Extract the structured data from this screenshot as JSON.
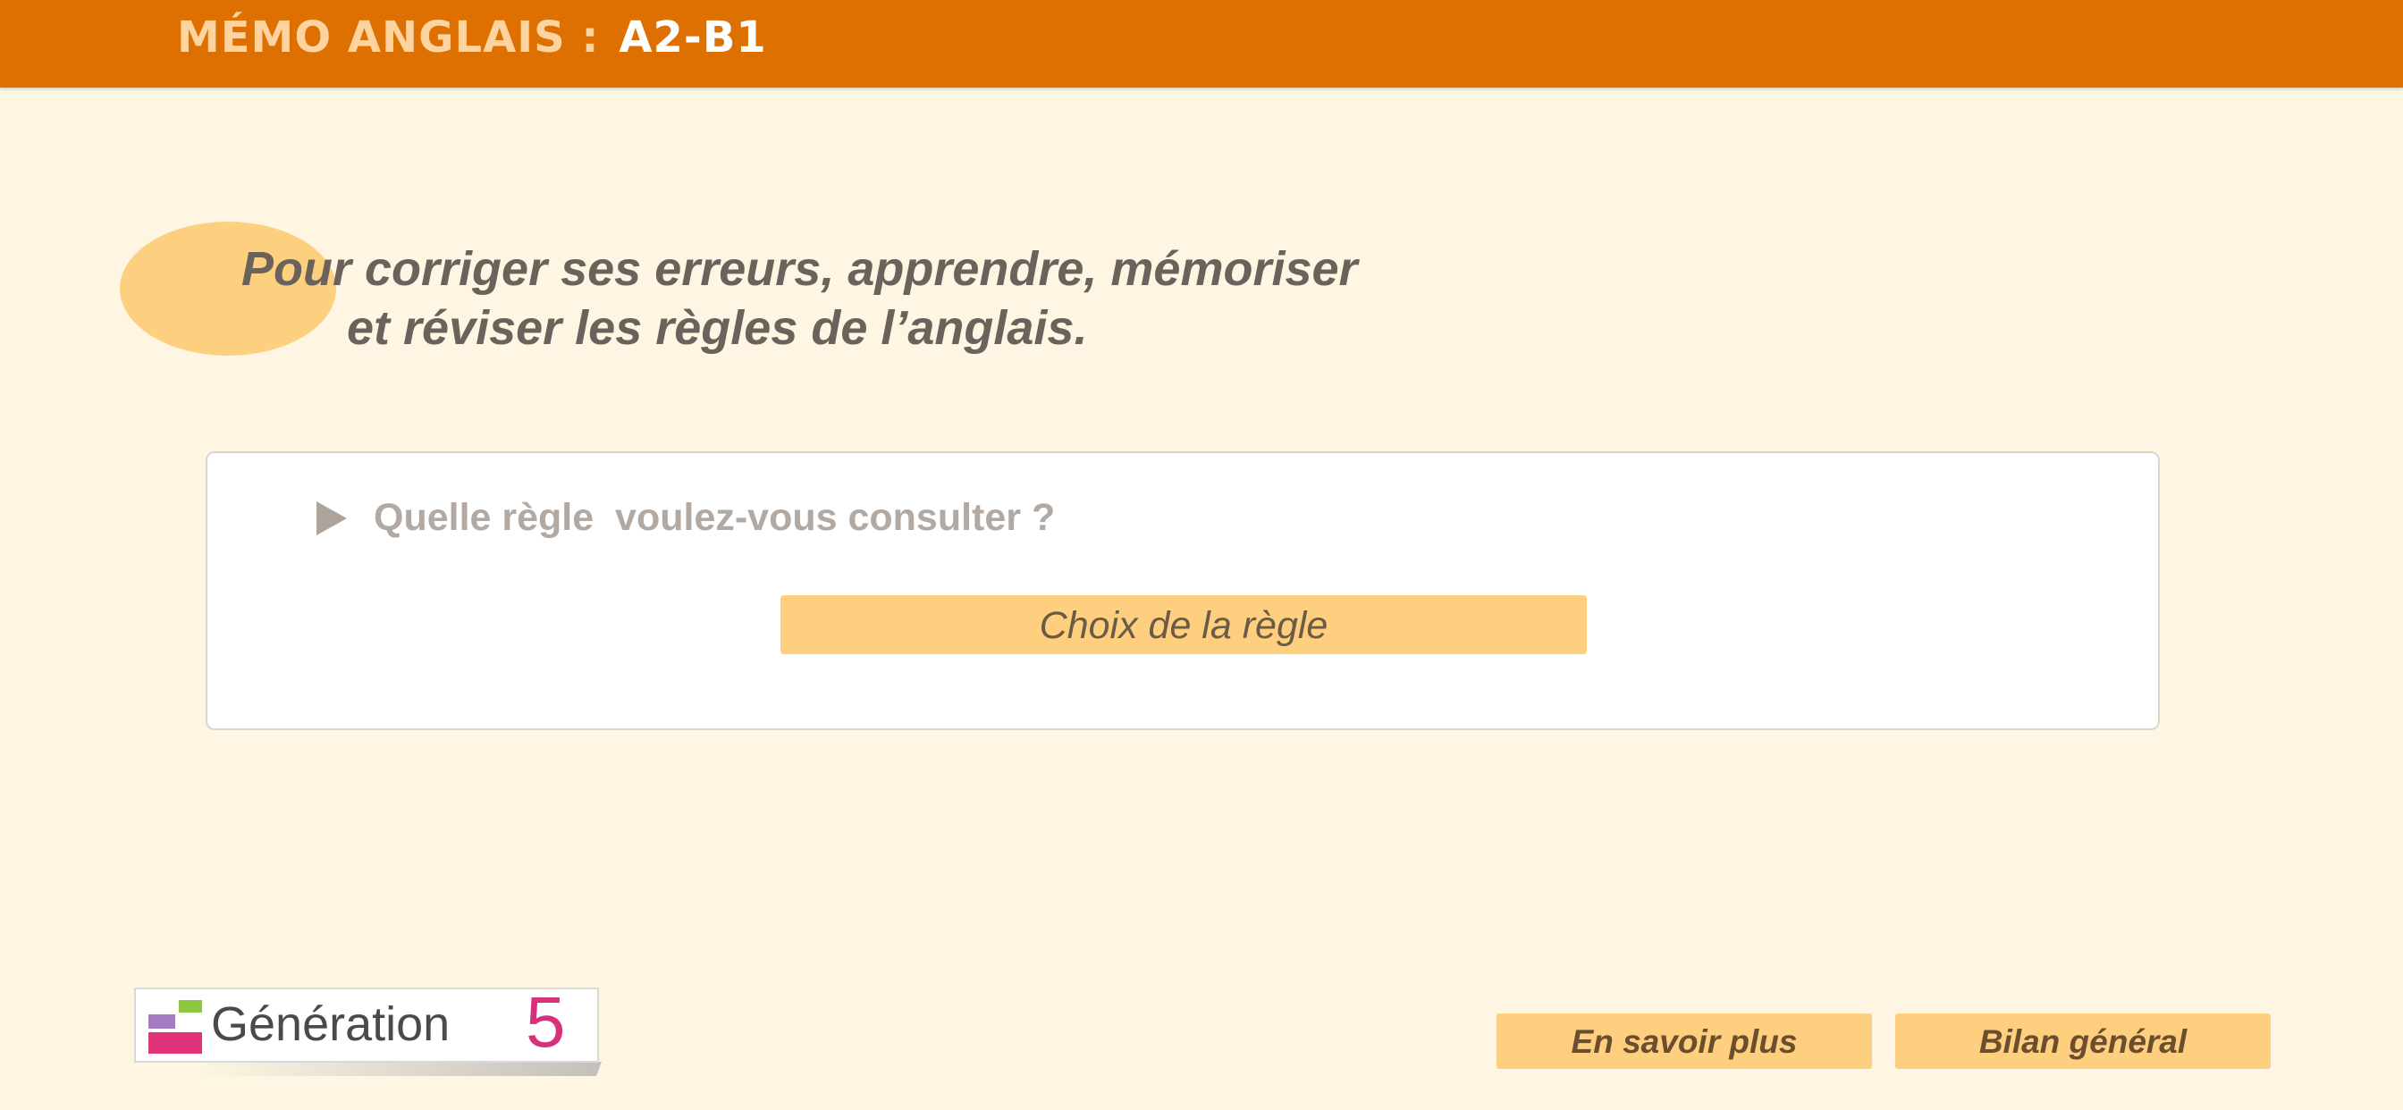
{
  "header": {
    "title": "MÉMO ANGLAIS :",
    "level": "A2-B1",
    "background_color": "#dd7000"
  },
  "intro": {
    "line1": "Pour corriger ses erreurs, apprendre, mémoriser",
    "line2": "et réviser les règles de l’anglais."
  },
  "panel": {
    "question": "Quelle règle  voulez-vous consulter ?",
    "question_icon": "play-triangle-icon",
    "choice_button_label": "Choix de la règle"
  },
  "logo": {
    "word": "Génération",
    "number": "5"
  },
  "footer": {
    "more_label": "En savoir plus",
    "summary_label": "Bilan général"
  },
  "colors": {
    "accent": "#dd7000",
    "button": "#fecf7f",
    "background": "#fef6e3"
  }
}
